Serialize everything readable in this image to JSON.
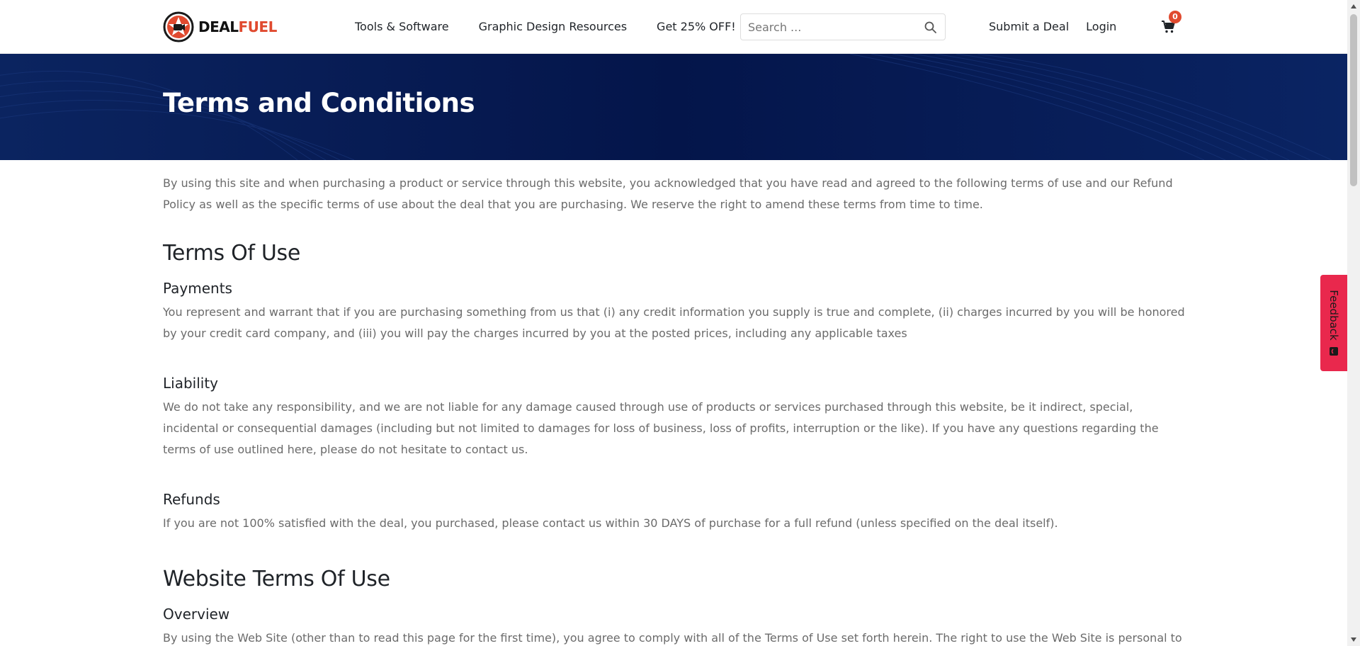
{
  "header": {
    "logo": {
      "deal": "DEAL",
      "fuel": "FUEL"
    },
    "nav": [
      {
        "label": "Tools & Software"
      },
      {
        "label": "Graphic Design Resources"
      },
      {
        "label": "Get 25% OFF!"
      }
    ],
    "search": {
      "placeholder": "Search ...",
      "value": ""
    },
    "submit_deal": "Submit a Deal",
    "login": "Login",
    "cart_count": "0"
  },
  "banner": {
    "title": "Terms and Conditions"
  },
  "content": {
    "intro": "By using this site and when purchasing a product or service through this website, you acknowledged that you have read and agreed to the following terms of use and our Refund Policy as well as the specific terms of use about the deal that you are purchasing. We reserve the right to amend these terms from time to time.",
    "terms_of_use": {
      "title": "Terms Of Use",
      "payments": {
        "title": "Payments",
        "text": "You represent and warrant that if you are purchasing something from us that (i) any credit information you supply is true and complete, (ii) charges incurred by you will be honored by your credit card company, and (iii) you will pay the charges incurred by you at the posted prices, including any applicable taxes"
      },
      "liability": {
        "title": "Liability",
        "text": "We do not take any responsibility, and we are not liable for any damage caused through use of products or services purchased through this website, be it indirect, special, incidental or consequential damages (including but not limited to damages for loss of business, loss of profits, interruption or the like). If you have any questions regarding the terms of use outlined here, please do not hesitate to contact us."
      },
      "refunds": {
        "title": "Refunds",
        "text": "If you are not 100% satisfied with the deal, you purchased, please contact us within 30 DAYS of purchase for a full refund (unless specified on the deal itself)."
      }
    },
    "website_terms": {
      "title": "Website Terms Of Use",
      "overview": {
        "title": "Overview",
        "text": "By using the Web Site (other than to read this page for the first time), you agree to comply with all of the Terms of Use set forth herein. The right to use the Web Site is personal to you"
      }
    }
  },
  "feedback": {
    "label": "Feedback"
  },
  "colors": {
    "accent": "#e04a2f",
    "banner": "#061a55",
    "feedback": "#e9284d"
  },
  "icons": {
    "search": "search-icon",
    "cart": "cart-icon",
    "feedback": "feedback-icon"
  }
}
